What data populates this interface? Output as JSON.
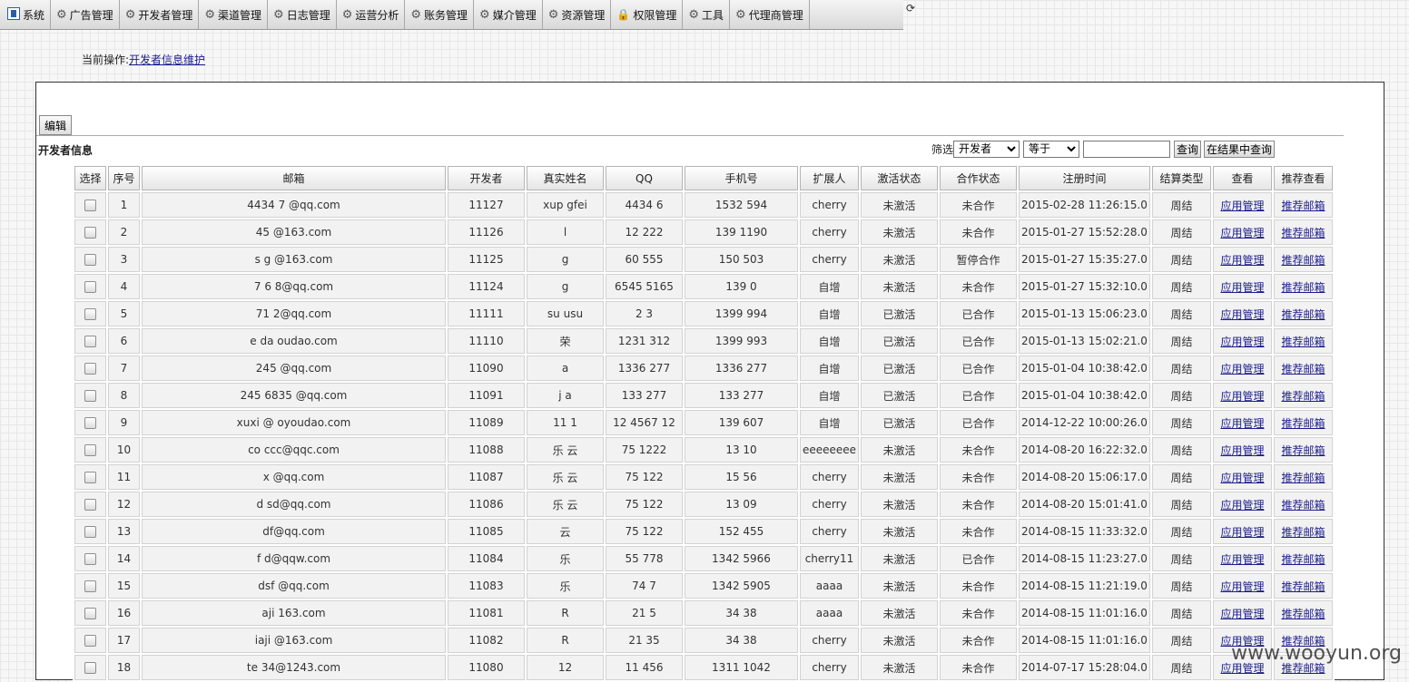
{
  "nav": {
    "items": [
      {
        "label": "系统",
        "icon": "system-icon"
      },
      {
        "label": "广告管理",
        "icon": "network-icon"
      },
      {
        "label": "开发者管理",
        "icon": "network-icon"
      },
      {
        "label": "渠道管理",
        "icon": "network-icon"
      },
      {
        "label": "日志管理",
        "icon": "network-icon"
      },
      {
        "label": "运营分析",
        "icon": "network-icon"
      },
      {
        "label": "账务管理",
        "icon": "network-icon"
      },
      {
        "label": "媒介管理",
        "icon": "network-icon"
      },
      {
        "label": "资源管理",
        "icon": "network-icon"
      },
      {
        "label": "权限管理",
        "icon": "lock-icon"
      },
      {
        "label": "工具",
        "icon": "network-icon"
      },
      {
        "label": "代理商管理",
        "icon": "network-icon"
      }
    ]
  },
  "breadcrumb": {
    "prefix": "当前操作:",
    "link": "开发者信息维护"
  },
  "toolbar": {
    "edit_label": "编辑"
  },
  "section": {
    "title": "开发者信息"
  },
  "filter": {
    "label": "筛选",
    "field_value": "开发者",
    "operator_value": "等于",
    "query_value": "",
    "query_label": "查询",
    "query_in_results_label": "在结果中查询"
  },
  "table": {
    "columns": [
      "选择",
      "序号",
      "邮箱",
      "开发者",
      "真实姓名",
      "QQ",
      "手机号",
      "扩展人",
      "激活状态",
      "合作状态",
      "注册时间",
      "结算类型",
      "查看",
      "推荐查看"
    ],
    "rows": [
      {
        "index": "1",
        "email": "4434 7 @qq.com",
        "developer": "11127",
        "real_name": "xup gfei",
        "qq": "4434 6",
        "phone": "1532 594",
        "extender": "cherry",
        "activation": "未激活",
        "cooperation": "未合作",
        "reg_time": "2015-02-28 11:26:15.0",
        "settle": "周结",
        "view": "应用管理",
        "recommend": "推荐邮箱"
      },
      {
        "index": "2",
        "email": "45 @163.com",
        "developer": "11126",
        "real_name": "l",
        "qq": "12 222",
        "phone": "139 1190",
        "extender": "cherry",
        "activation": "未激活",
        "cooperation": "未合作",
        "reg_time": "2015-01-27 15:52:28.0",
        "settle": "周结",
        "view": "应用管理",
        "recommend": "推荐邮箱"
      },
      {
        "index": "3",
        "email": "s g @163.com",
        "developer": "11125",
        "real_name": "g",
        "qq": "60 555",
        "phone": "150 503",
        "extender": "cherry",
        "activation": "未激活",
        "cooperation": "暂停合作",
        "reg_time": "2015-01-27 15:35:27.0",
        "settle": "周结",
        "view": "应用管理",
        "recommend": "推荐邮箱"
      },
      {
        "index": "4",
        "email": "7 6 8@qq.com",
        "developer": "11124",
        "real_name": "g",
        "qq": "6545 5165",
        "phone": "139 0",
        "extender": "自增",
        "activation": "未激活",
        "cooperation": "未合作",
        "reg_time": "2015-01-27 15:32:10.0",
        "settle": "周结",
        "view": "应用管理",
        "recommend": "推荐邮箱"
      },
      {
        "index": "5",
        "email": "71 2@qq.com",
        "developer": "11111",
        "real_name": "su usu",
        "qq": "2 3",
        "phone": "1399 994",
        "extender": "自增",
        "activation": "已激活",
        "cooperation": "已合作",
        "reg_time": "2015-01-13 15:06:23.0",
        "settle": "周结",
        "view": "应用管理",
        "recommend": "推荐邮箱"
      },
      {
        "index": "6",
        "email": "e da oudao.com",
        "developer": "11110",
        "real_name": "荣",
        "qq": "1231 312",
        "phone": "1399 993",
        "extender": "自增",
        "activation": "已激活",
        "cooperation": "已合作",
        "reg_time": "2015-01-13 15:02:21.0",
        "settle": "周结",
        "view": "应用管理",
        "recommend": "推荐邮箱"
      },
      {
        "index": "7",
        "email": "245 @qq.com",
        "developer": "11090",
        "real_name": "a",
        "qq": "1336 277",
        "phone": "1336 277",
        "extender": "自增",
        "activation": "已激活",
        "cooperation": "已合作",
        "reg_time": "2015-01-04 10:38:42.0",
        "settle": "周结",
        "view": "应用管理",
        "recommend": "推荐邮箱"
      },
      {
        "index": "8",
        "email": "245 6835 @qq.com",
        "developer": "11091",
        "real_name": "j a",
        "qq": "133 277",
        "phone": "133 277",
        "extender": "自增",
        "activation": "已激活",
        "cooperation": "已合作",
        "reg_time": "2015-01-04 10:38:42.0",
        "settle": "周结",
        "view": "应用管理",
        "recommend": "推荐邮箱"
      },
      {
        "index": "9",
        "email": "xuxi @ oyoudao.com",
        "developer": "11089",
        "real_name": "11 1",
        "qq": "12 4567 12",
        "phone": "139 607",
        "extender": "自增",
        "activation": "已激活",
        "cooperation": "已合作",
        "reg_time": "2014-12-22 10:00:26.0",
        "settle": "周结",
        "view": "应用管理",
        "recommend": "推荐邮箱"
      },
      {
        "index": "10",
        "email": "co ccc@qqc.com",
        "developer": "11088",
        "real_name": "乐 云",
        "qq": "75 1222",
        "phone": "13 10",
        "extender": "eeeeeeee",
        "activation": "未激活",
        "cooperation": "未合作",
        "reg_time": "2014-08-20 16:22:32.0",
        "settle": "周结",
        "view": "应用管理",
        "recommend": "推荐邮箱"
      },
      {
        "index": "11",
        "email": "x @qq.com",
        "developer": "11087",
        "real_name": "乐 云",
        "qq": "75 122",
        "phone": "15 56",
        "extender": "cherry",
        "activation": "未激活",
        "cooperation": "未合作",
        "reg_time": "2014-08-20 15:06:17.0",
        "settle": "周结",
        "view": "应用管理",
        "recommend": "推荐邮箱"
      },
      {
        "index": "12",
        "email": "d sd@qq.com",
        "developer": "11086",
        "real_name": "乐 云",
        "qq": "75 122",
        "phone": "13 09",
        "extender": "cherry",
        "activation": "未激活",
        "cooperation": "未合作",
        "reg_time": "2014-08-20 15:01:41.0",
        "settle": "周结",
        "view": "应用管理",
        "recommend": "推荐邮箱"
      },
      {
        "index": "13",
        "email": "df@qq.com",
        "developer": "11085",
        "real_name": "云",
        "qq": "75 122",
        "phone": "152 455",
        "extender": "cherry",
        "activation": "未激活",
        "cooperation": "未合作",
        "reg_time": "2014-08-15 11:33:32.0",
        "settle": "周结",
        "view": "应用管理",
        "recommend": "推荐邮箱"
      },
      {
        "index": "14",
        "email": "f d@qqw.com",
        "developer": "11084",
        "real_name": "乐",
        "qq": "55 778",
        "phone": "1342 5966",
        "extender": "cherry11",
        "activation": "未激活",
        "cooperation": "已合作",
        "reg_time": "2014-08-15 11:23:27.0",
        "settle": "周结",
        "view": "应用管理",
        "recommend": "推荐邮箱"
      },
      {
        "index": "15",
        "email": "dsf @qq.com",
        "developer": "11083",
        "real_name": "乐",
        "qq": "74 7",
        "phone": "1342 5905",
        "extender": "aaaa",
        "activation": "未激活",
        "cooperation": "未合作",
        "reg_time": "2014-08-15 11:21:19.0",
        "settle": "周结",
        "view": "应用管理",
        "recommend": "推荐邮箱"
      },
      {
        "index": "16",
        "email": "aji 163.com",
        "developer": "11081",
        "real_name": "R",
        "qq": "21 5",
        "phone": "34 38",
        "extender": "aaaa",
        "activation": "未激活",
        "cooperation": "未合作",
        "reg_time": "2014-08-15 11:01:16.0",
        "settle": "周结",
        "view": "应用管理",
        "recommend": "推荐邮箱"
      },
      {
        "index": "17",
        "email": "iaji @163.com",
        "developer": "11082",
        "real_name": "R",
        "qq": "21 35",
        "phone": "34 38",
        "extender": "cherry",
        "activation": "未激活",
        "cooperation": "未合作",
        "reg_time": "2014-08-15 11:01:16.0",
        "settle": "周结",
        "view": "应用管理",
        "recommend": "推荐邮箱"
      },
      {
        "index": "18",
        "email": "te 34@1243.com",
        "developer": "11080",
        "real_name": "12",
        "qq": "11 456",
        "phone": "1311 1042",
        "extender": "cherry",
        "activation": "未激活",
        "cooperation": "未合作",
        "reg_time": "2014-07-17 15:28:04.0",
        "settle": "周结",
        "view": "应用管理",
        "recommend": "推荐邮箱"
      }
    ]
  },
  "watermark": "www.wooyun.org"
}
